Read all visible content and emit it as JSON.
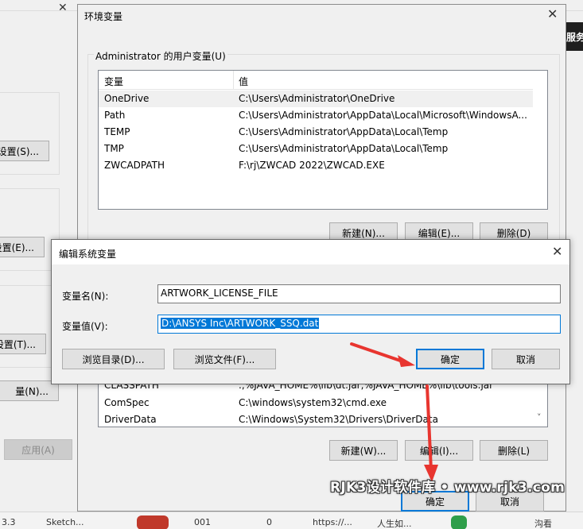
{
  "background": {
    "left_buttons": [
      "设置(S)...",
      "设置(E)...",
      "设置(T)...",
      "量(N)...",
      "应用(A)"
    ],
    "right_tab_text": "服务",
    "taskbar_items": [
      "3.3",
      "Sketch...",
      "001",
      "0",
      "https://...",
      "人生如...",
      "沟看"
    ]
  },
  "env_window": {
    "title": "环境变量",
    "close_glyph": "✕",
    "user_group_label": "Administrator 的用户变量(U)",
    "columns": [
      "变量",
      "值"
    ],
    "user_vars": [
      {
        "name": "OneDrive",
        "value": "C:\\Users\\Administrator\\OneDrive"
      },
      {
        "name": "Path",
        "value": "C:\\Users\\Administrator\\AppData\\Local\\Microsoft\\WindowsA..."
      },
      {
        "name": "TEMP",
        "value": "C:\\Users\\Administrator\\AppData\\Local\\Temp"
      },
      {
        "name": "TMP",
        "value": "C:\\Users\\Administrator\\AppData\\Local\\Temp"
      },
      {
        "name": "ZWCADPATH",
        "value": "F:\\rj\\ZWCAD 2022\\ZWCAD.EXE"
      }
    ],
    "user_buttons": {
      "new": "新建(N)...",
      "edit": "编辑(E)...",
      "delete": "删除(D)"
    },
    "sys_vars": [
      {
        "name": "CLASSPATH",
        "value": ".;%JAVA_HOME%\\lib\\dt.jar;%JAVA_HOME%\\lib\\tools.jar"
      },
      {
        "name": "ComSpec",
        "value": "C:\\windows\\system32\\cmd.exe"
      },
      {
        "name": "DriverData",
        "value": "C:\\Windows\\System32\\Drivers\\DriverData"
      }
    ],
    "sys_buttons": {
      "new": "新建(W)...",
      "edit": "编辑(I)...",
      "delete": "删除(L)"
    },
    "ok": "确定",
    "cancel": "取消"
  },
  "edit_dialog": {
    "title": "编辑系统变量",
    "close_glyph": "✕",
    "name_label": "变量名(N):",
    "name_value": "ARTWORK_LICENSE_FILE",
    "value_label": "变量值(V):",
    "value_value": "D:\\ANSYS Inc\\ARTWORK_SSQ.dat",
    "browse_dir": "浏览目录(D)...",
    "browse_file": "浏览文件(F)...",
    "ok": "确定",
    "cancel": "取消"
  },
  "watermark": "RJK3设计软件库 • www.rjk3.com",
  "colors": {
    "accent": "#0078d7",
    "arrow": "#e8352f",
    "window_bg": "#f0f0f0"
  },
  "icons": {
    "scroll_up": "˄",
    "scroll_down": "˅"
  }
}
